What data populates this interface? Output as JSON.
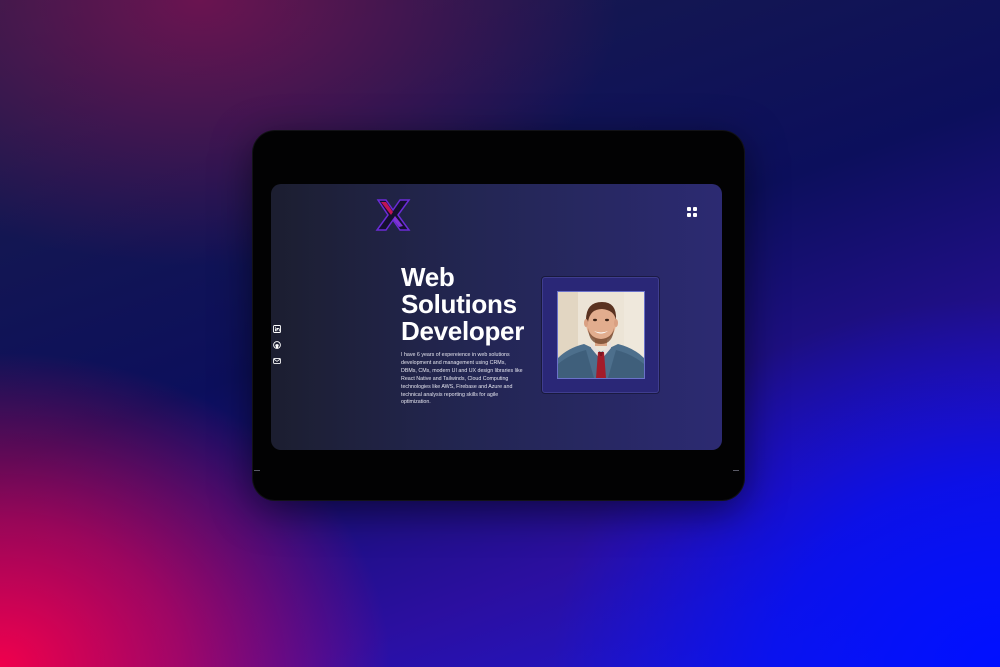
{
  "brand": {
    "logo": "x-logo-icon"
  },
  "header": {
    "menu_icon": "grid-menu-icon"
  },
  "social": [
    {
      "name": "linkedin-icon"
    },
    {
      "name": "github-icon"
    },
    {
      "name": "mail-icon"
    }
  ],
  "hero": {
    "title_line1": "Web",
    "title_line2": "Solutions",
    "title_line3": "Developer",
    "bio": "I have 6 years of expereience in web solutions development and management using CRMs, DBMs, CMs, modern UI and UX design libraries like React Native and Tailwinds, Cloud Computing technologies like AWS, Firebase and Azure and technical analysis reporting skills for agile optimization."
  },
  "profile": {
    "photo": "profile-photo"
  },
  "colors": {
    "screen_bg": "#232653",
    "frame": "#2a2777",
    "accent_pink": "#f0004c",
    "accent_blue": "#0010ff"
  }
}
